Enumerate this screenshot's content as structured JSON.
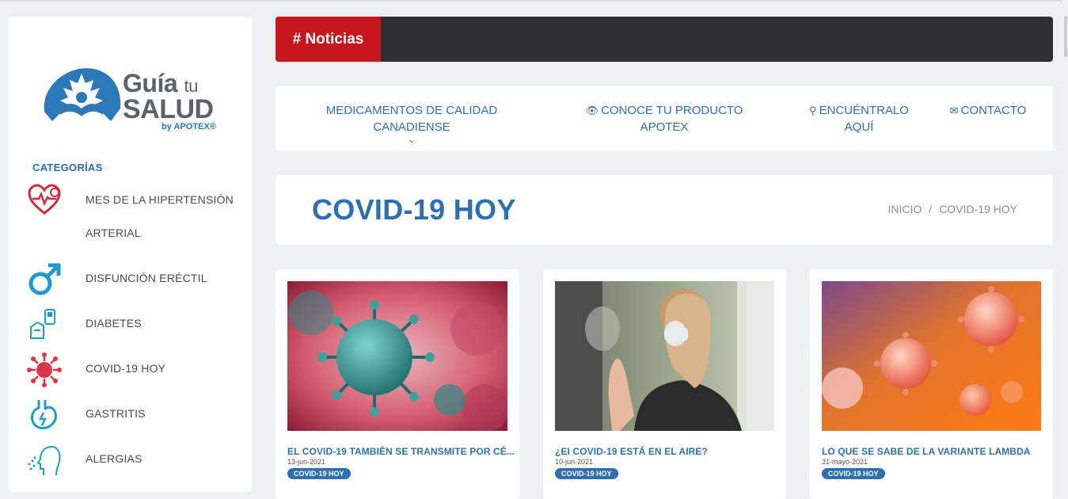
{
  "sidebar": {
    "brand_line1": "Guía",
    "brand_tu": "tu",
    "brand_line2": "SALUD",
    "brand_by": "by APOTEX®",
    "categories_title": "CATEGORÍAS",
    "items": [
      {
        "label": "MES DE LA HIPERTENSIÓN",
        "label2": "ARTERIAL",
        "icon": "heart-pulse-icon"
      },
      {
        "label": "DISFUNCIÓN ERÉCTIL",
        "icon": "male-symbol-icon"
      },
      {
        "label": "DIABETES",
        "icon": "glucometer-icon"
      },
      {
        "label": "COVID-19 HOY",
        "icon": "virus-icon"
      },
      {
        "label": "GASTRITIS",
        "icon": "stomach-icon"
      },
      {
        "label": "ALERGIAS",
        "icon": "allergy-head-icon"
      }
    ]
  },
  "header": {
    "tag": "# Noticias"
  },
  "nav": {
    "items": [
      {
        "label": "MEDICAMENTOS DE CALIDAD CANADIENSE",
        "icon": "chevron-down-icon"
      },
      {
        "label": "CONOCE TU PRODUCTO APOTEX",
        "icon": "eye-icon"
      },
      {
        "label": "ENCUÉNTRALO",
        "label2": "AQUÍ",
        "icon": "map-marker-icon"
      },
      {
        "label": "CONTACTO",
        "icon": "envelope-icon"
      }
    ]
  },
  "page": {
    "title": "COVID-19 HOY",
    "breadcrumb": [
      "INICIO",
      "/",
      "COVID-19 HOY"
    ]
  },
  "cards": [
    {
      "title": "EL COVID-19 TAMBIÉN SE TRANSMITE POR CÉ...",
      "date": "13-jun-2021",
      "badge": "COVID-19 HOY"
    },
    {
      "title": "¿EI COVID-19 ESTÁ EN EL AIRE?",
      "date": "10-jun-2021",
      "badge": "COVID-19 HOY"
    },
    {
      "title": "LO QUE SE SABE DE LA VARIANTE LAMBDA",
      "date": "31-mayo-2021",
      "badge": "COVID-19 HOY"
    }
  ],
  "colors": {
    "accent": "#2f6fb0",
    "red": "#c8161d",
    "dark": "#2f2f32",
    "bg": "#eef1f4"
  }
}
